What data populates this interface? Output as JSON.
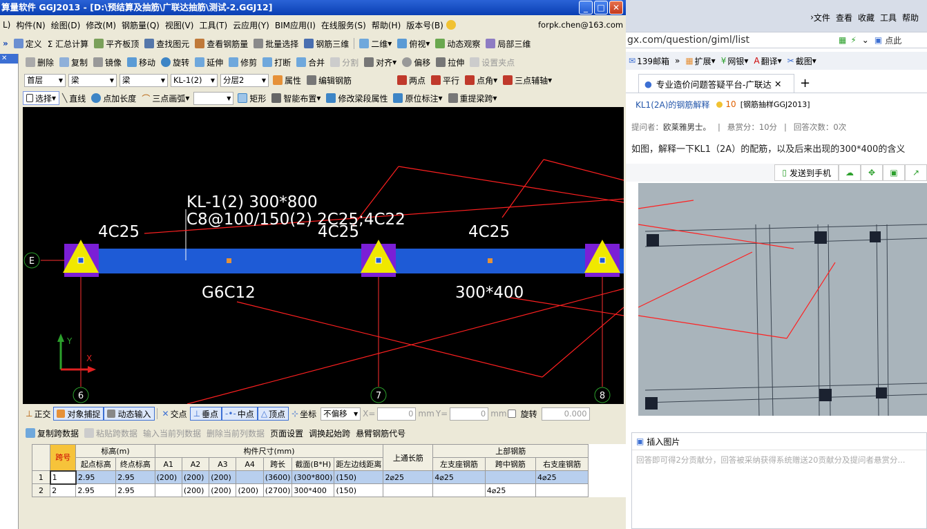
{
  "app": {
    "title": "算量软件 GGJ2013 - [D:\\预结算及抽筋\\广联达抽筋\\测试-2.GGJ12]",
    "menu": [
      "L)",
      "构件(N)",
      "绘图(D)",
      "修改(M)",
      "钢筋量(Q)",
      "视图(V)",
      "工具(T)",
      "云应用(Y)",
      "BIM应用(I)",
      "在线服务(S)",
      "帮助(H)",
      "版本号(B)"
    ],
    "account": "forpk.chen@163.com",
    "toolbar1": [
      "定义",
      "Σ 汇总计算",
      "平齐板顶",
      "查找图元",
      "查看钢筋量",
      "批量选择",
      "钢筋三维",
      "二维",
      "俯视",
      "动态观察",
      "局部三维"
    ],
    "toolbar2": [
      "删除",
      "复制",
      "镜像",
      "移动",
      "旋转",
      "延伸",
      "修剪",
      "打断",
      "合并",
      "分割",
      "对齐",
      "偏移",
      "拉伸",
      "设置夹点"
    ],
    "selectors": {
      "floor": "首层",
      "type1": "梁",
      "type2": "梁",
      "member": "KL-1(2)",
      "layer": "分层2"
    },
    "toolbar3_actions": [
      "属性",
      "编辑钢筋",
      "两点",
      "平行",
      "点角",
      "三点辅轴"
    ],
    "toolbar4": [
      "选择",
      "直线",
      "点加长度",
      "三点画弧",
      "矩形",
      "智能布置",
      "修改梁段属性",
      "原位标注",
      "重提梁跨"
    ],
    "canvas": {
      "beam_label_line1": "KL-1(2) 300*800",
      "beam_label_line2": "C8@100/150(2) 2C25;4C22",
      "top_left": "4C25",
      "top_mid": "4C25",
      "top_right": "4C25",
      "bottom_bar": "G6C12",
      "section2": "300*400",
      "axis_row": "E",
      "axis_cols": [
        "6",
        "7",
        "8"
      ],
      "y_axis": "Y",
      "x_axis": "X"
    },
    "status_bar": {
      "items": [
        "正交",
        "对象捕捉",
        "动态输入",
        "交点",
        "垂点",
        "中点",
        "顶点",
        "坐标"
      ],
      "offset_mode": "不偏移",
      "x_label": "X=",
      "x_value": "0",
      "x_unit": "mm",
      "y_label": "Y=",
      "y_value": "0",
      "y_unit": "mm",
      "rotate_label": "旋转",
      "rotate_value": "0.000"
    },
    "grid_toolbar": [
      "复制跨数据",
      "粘贴跨数据",
      "输入当前列数据",
      "删除当前列数据",
      "页面设置",
      "调换起始跨",
      "悬臂钢筋代号"
    ],
    "grid": {
      "group_headers": {
        "elev": "标高(m)",
        "size": "构件尺寸(mm)",
        "top": "上部钢筋"
      },
      "headers": [
        "跨号",
        "起点标高",
        "终点标高",
        "A1",
        "A2",
        "A3",
        "A4",
        "跨长",
        "截面(B*H)",
        "距左边线距离",
        "上通长筋",
        "左支座钢筋",
        "跨中钢筋",
        "右支座钢筋"
      ],
      "rows": [
        [
          "1",
          "1",
          "2.95",
          "2.95",
          "(200)",
          "(200)",
          "(200)",
          "",
          "(3600)",
          "(300*800)",
          "(150)",
          "2⌀25",
          "4⌀25",
          "",
          "4⌀25"
        ],
        [
          "2",
          "2",
          "2.95",
          "2.95",
          "",
          "(200)",
          "(200)",
          "(200)",
          "(2700)",
          "300*400",
          "(150)",
          "",
          "",
          "4⌀25",
          ""
        ]
      ]
    }
  },
  "browser": {
    "menu": [
      "文件",
      "查看",
      "收藏",
      "工具",
      "帮助"
    ],
    "address": "gx.com/question/giml/list",
    "address_search": "点此",
    "bookmarks": [
      "139邮箱",
      "扩展",
      "网银",
      "翻译",
      "截图"
    ],
    "tab_title": "专业造价问题答疑平台-广联达",
    "question_title": "KL1(2A)的钢筋解释",
    "reward_points": "10",
    "question_tag": "[钢筋抽样GGJ2013]",
    "asker_label": "提问者：",
    "asker_name": "欧莱雅男士。",
    "bounty": "悬赏分：10分",
    "answers": "回答次数：0次",
    "question_body": "如图，解释一下KL1（2A）的配筋，以及后来出现的300*400的含义",
    "send_to_phone": "发送到手机",
    "insert_image": "插入图片",
    "answer_placeholder": "回答即可得2分贡献分，回答被采纳获得系统赠送20贡献分及提问者悬赏分..."
  },
  "colors": {
    "beam": "#1e5bd6",
    "support": "#f0e800",
    "annot": "#ff2020",
    "canvas_bg": "#000000",
    "title_blue": "#0a3fb3"
  }
}
